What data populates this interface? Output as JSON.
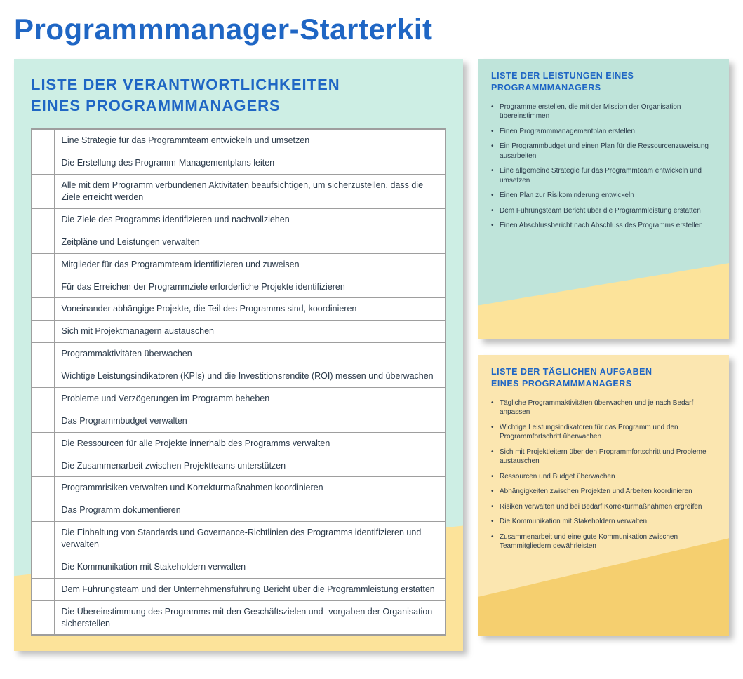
{
  "page_title": "Programmmanager-Starterkit",
  "main_card": {
    "heading_line1": "LISTE DER VERANTWORTLICHKEITEN",
    "heading_line2": "EINES PROGRAMMMANAGERS",
    "rows": [
      "Eine Strategie für das Programmteam entwickeln und umsetzen",
      "Die Erstellung des Programm-Managementplans leiten",
      "Alle mit dem Programm verbundenen Aktivitäten beaufsichtigen, um sicherzustellen, dass die Ziele erreicht werden",
      "Die Ziele des Programms identifizieren und nachvollziehen",
      "Zeitpläne und Leistungen verwalten",
      "Mitglieder für das Programmteam identifizieren und zuweisen",
      "Für das Erreichen der Programmziele erforderliche Projekte identifizieren",
      "Voneinander abhängige Projekte, die Teil des Programms sind, koordinieren",
      "Sich mit Projektmanagern austauschen",
      "Programmaktivitäten überwachen",
      "Wichtige Leistungsindikatoren (KPIs) und die Investitionsrendite (ROI) messen und überwachen",
      "Probleme und Verzögerungen im Programm beheben",
      "Das Programmbudget verwalten",
      "Die Ressourcen für alle Projekte innerhalb des Programms verwalten",
      "Die Zusammenarbeit zwischen Projektteams unterstützen",
      "Programmrisiken verwalten und Korrekturmaßnahmen koordinieren",
      "Das Programm dokumentieren",
      "Die Einhaltung von Standards und Governance-Richtlinien des Programms identifizieren und verwalten",
      "Die Kommunikation mit Stakeholdern verwalten",
      "Dem Führungsteam und der Unternehmensführung Bericht über die Programmleistung erstatten",
      "Die Übereinstimmung des Programms mit den Geschäftszielen und -vorgaben der Organisation sicherstellen"
    ]
  },
  "side_card_1": {
    "heading_line1": "LISTE DER LEISTUNGEN EINES",
    "heading_line2": "PROGRAMMMANAGERS",
    "items": [
      "Programme erstellen, die mit der Mission der Organisation übereinstimmen",
      "Einen Programmmanagementplan erstellen",
      "Ein Programmbudget und einen Plan für die Ressourcenzuweisung ausarbeiten",
      "Eine allgemeine Strategie für das Programmteam entwickeln und umsetzen",
      "Einen Plan zur Risikominderung entwickeln",
      "Dem Führungsteam Bericht über die Programmleistung erstatten",
      "Einen Abschlussbericht nach Abschluss des Programms erstellen"
    ]
  },
  "side_card_2": {
    "heading_line1": "LISTE DER TÄGLICHEN AUFGABEN",
    "heading_line2": "EINES PROGRAMMMANAGERS",
    "items": [
      "Tägliche Programmaktivitäten überwachen und je nach Bedarf anpassen",
      "Wichtige Leistungsindikatoren für das Programm und den Programmfortschritt überwachen",
      "Sich mit Projektleitern über den Programmfortschritt und Probleme austauschen",
      "Ressourcen und Budget überwachen",
      "Abhängigkeiten zwischen Projekten und Arbeiten koordinieren",
      "Risiken verwalten und bei Bedarf Korrekturmaßnahmen ergreifen",
      "Die Kommunikation mit Stakeholdern verwalten",
      "Zusammenarbeit und eine gute Kommunikation zwischen Teammitgliedern gewährleisten"
    ]
  }
}
